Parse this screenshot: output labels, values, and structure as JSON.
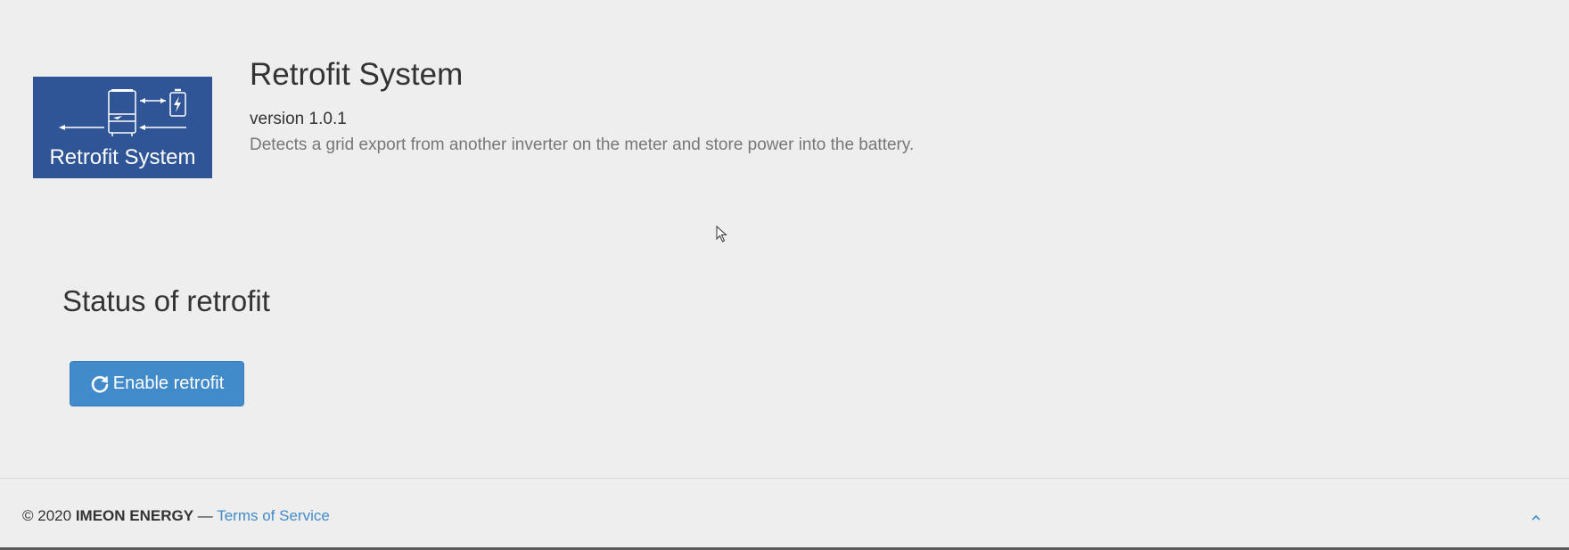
{
  "app": {
    "logo_text": "Retrofit System",
    "title": "Retrofit System",
    "version": "version 1.0.1",
    "description": "Detects a grid export from another inverter on the meter and store power into the battery."
  },
  "status": {
    "heading": "Status of retrofit",
    "enable_button_label": "Enable retrofit",
    "enable_button_icon": "refresh-icon"
  },
  "footer": {
    "copyright": "© 2020",
    "brand": "IMEON ENERGY",
    "separator": "—",
    "terms_label": "Terms of Service",
    "scroll_top_icon": "chevron-up-icon"
  },
  "colors": {
    "background": "#eeeeee",
    "logo_blue": "#2f5597",
    "button_blue": "#428bca",
    "link_blue": "#428bca",
    "text_dark": "#333333",
    "text_muted": "#777777"
  }
}
